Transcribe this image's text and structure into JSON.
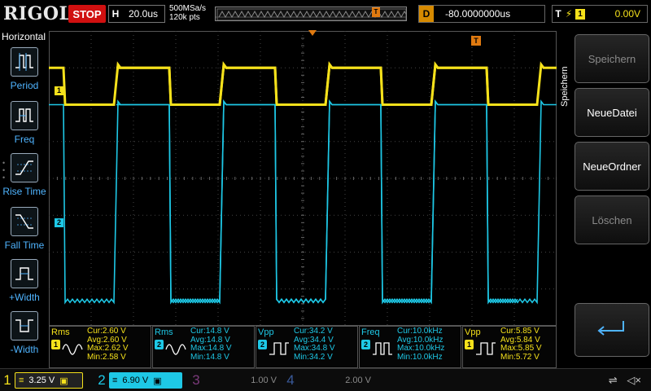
{
  "brand": "RIGOL",
  "run_state": "STOP",
  "horizontal": {
    "key": "H",
    "timebase": "20.0us"
  },
  "acquire": {
    "sample_rate": "500MSa/s",
    "points": "120k pts"
  },
  "delay": {
    "key": "D",
    "value": "-80.0000000us"
  },
  "trigger": {
    "key": "T",
    "source": "1",
    "level": "0.00V"
  },
  "left_menu": {
    "title": "Horizontal",
    "items": [
      {
        "label": "Period",
        "icon": "period-icon"
      },
      {
        "label": "Freq",
        "icon": "frequency-icon"
      },
      {
        "label": "Rise Time",
        "icon": "rise-time-icon"
      },
      {
        "label": "Fall Time",
        "icon": "fall-time-icon"
      },
      {
        "label": "+Width",
        "icon": "positive-width-icon"
      },
      {
        "label": "-Width",
        "icon": "negative-width-icon"
      }
    ]
  },
  "right_menu": {
    "title": "Speichern",
    "buttons": [
      {
        "label": "Speichern",
        "enabled": false
      },
      {
        "label": "NeueDatei",
        "enabled": true
      },
      {
        "label": "NeueOrdner",
        "enabled": true
      },
      {
        "label": "Löschen",
        "enabled": false
      }
    ],
    "return_icon": "return-arrow-icon"
  },
  "channel_markers": [
    {
      "label": "1",
      "color": "#f5e11b"
    },
    {
      "label": "2",
      "color": "#1ec8e6"
    }
  ],
  "measurements": [
    {
      "name": "Rms",
      "channel": "1",
      "color": "#f5e11b",
      "glyph": "rms-icon",
      "cur": "Cur:2.60 V",
      "avg": "Avg:2.60 V",
      "max": "Max:2.62 V",
      "min": "Min:2.58 V"
    },
    {
      "name": "Rms",
      "channel": "2",
      "color": "#1ec8e6",
      "glyph": "rms-icon",
      "cur": "Cur:14.8 V",
      "avg": "Avg:14.8 V",
      "max": "Max:14.8 V",
      "min": "Min:14.8 V"
    },
    {
      "name": "Vpp",
      "channel": "2",
      "color": "#1ec8e6",
      "glyph": "vpp-icon",
      "cur": "Cur:34.2 V",
      "avg": "Avg:34.4 V",
      "max": "Max:34.8 V",
      "min": "Min:34.2 V"
    },
    {
      "name": "Freq",
      "channel": "2",
      "color": "#1ec8e6",
      "glyph": "frequency-icon",
      "cur": "Cur:10.0kHz",
      "avg": "Avg:10.0kHz",
      "max": "Max:10.0kHz",
      "min": "Min:10.0kHz"
    },
    {
      "name": "Vpp",
      "channel": "1",
      "color": "#f5e11b",
      "glyph": "vpp-icon",
      "cur": "Cur:5.85 V",
      "avg": "Avg:5.84 V",
      "max": "Max:5.85 V",
      "min": "Min:5.72 V"
    }
  ],
  "channels_bar": [
    {
      "num": "1",
      "scale": "3.25 V",
      "active": true,
      "color": "#f5e11b"
    },
    {
      "num": "2",
      "scale": "6.90 V",
      "active": true,
      "color": "#1ec8e6"
    },
    {
      "num": "3",
      "scale": "1.00 V",
      "active": false,
      "color": "#c040c0"
    },
    {
      "num": "4",
      "scale": "2.00 V",
      "active": false,
      "color": "#3a6ad0"
    }
  ],
  "status_icons": [
    "usb-icon",
    "speaker-muted-icon"
  ],
  "waveforms": {
    "ch1": {
      "color": "#f5e11b",
      "high_div": 1.0,
      "low_div": 2.0,
      "period_div": 2.5,
      "phase_div": 0.0,
      "duty": 0.5
    },
    "ch2": {
      "color": "#1ec8e6",
      "high_div": 2.0,
      "low_div": 7.3,
      "period_div": 2.5,
      "phase_div": 0.0,
      "duty": 0.5
    }
  }
}
